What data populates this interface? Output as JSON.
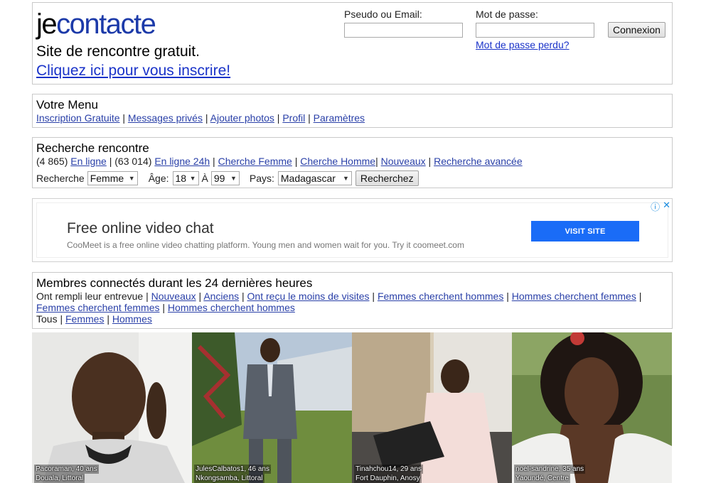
{
  "header": {
    "logo_part1": "je",
    "logo_part2": "contacte",
    "tagline": "Site de rencontre gratuit.",
    "signup_link": "Cliquez ici pour vous inscrire!",
    "login_label": "Pseudo ou Email:",
    "password_label": "Mot de passe:",
    "login_button": "Connexion",
    "forgot_link": "Mot de passe perdu?"
  },
  "menu": {
    "title": "Votre Menu",
    "items": [
      "Inscription Gratuite",
      "Messages privés",
      "Ajouter photos",
      "Profil",
      "Paramètres"
    ]
  },
  "search": {
    "title": "Recherche rencontre",
    "online_count": "(4 865)",
    "online_link": "En ligne",
    "online24_count": "(63 014)",
    "online24_link": "En ligne 24h",
    "links": [
      "Cherche Femme",
      "Cherche Homme",
      "Nouveaux",
      "Recherche avancée"
    ],
    "recherche_label": "Recherche",
    "gender_value": "Femme",
    "age_label": "Âge:",
    "age_min": "18",
    "a_label": "À",
    "age_max": "99",
    "country_label": "Pays:",
    "country_value": "Madagascar",
    "search_button": "Recherchez"
  },
  "ad": {
    "title": "Free online video chat",
    "description": "CooMeet is a free online video chatting platform. Young men and women wait for you. Try it coomeet.com",
    "button": "VISIT SITE",
    "info_icon": "ⓘ",
    "close_icon": "✕"
  },
  "members": {
    "title": "Membres connectés durant les 24 dernières heures",
    "filter_label": "Ont rempli leur entrevue",
    "filters": [
      "Nouveaux",
      "Anciens",
      "Ont reçu le moins de visites",
      "Femmes cherchent hommes",
      "Hommes cherchent femmes",
      "Femmes cherchent femmes",
      "Hommes cherchent hommes"
    ],
    "gender_label": "Tous",
    "gender_links": [
      "Femmes",
      "Hommes"
    ]
  },
  "profiles": [
    {
      "name": "Pacoraman, 40 ans",
      "location": "Douala, Littoral"
    },
    {
      "name": "JulesCalbatos1, 46 ans",
      "location": "Nkongsamba, Littoral"
    },
    {
      "name": "Tinahchou14, 29 ans",
      "location": "Fort Dauphin, Anosy"
    },
    {
      "name": "noel-sandrine, 35 ans",
      "location": "Yaoundé, Centre"
    }
  ],
  "colors": {
    "link": "#1a0dab",
    "logo_blue": "#1c3aa9",
    "ad_button": "#1a6cf7"
  }
}
